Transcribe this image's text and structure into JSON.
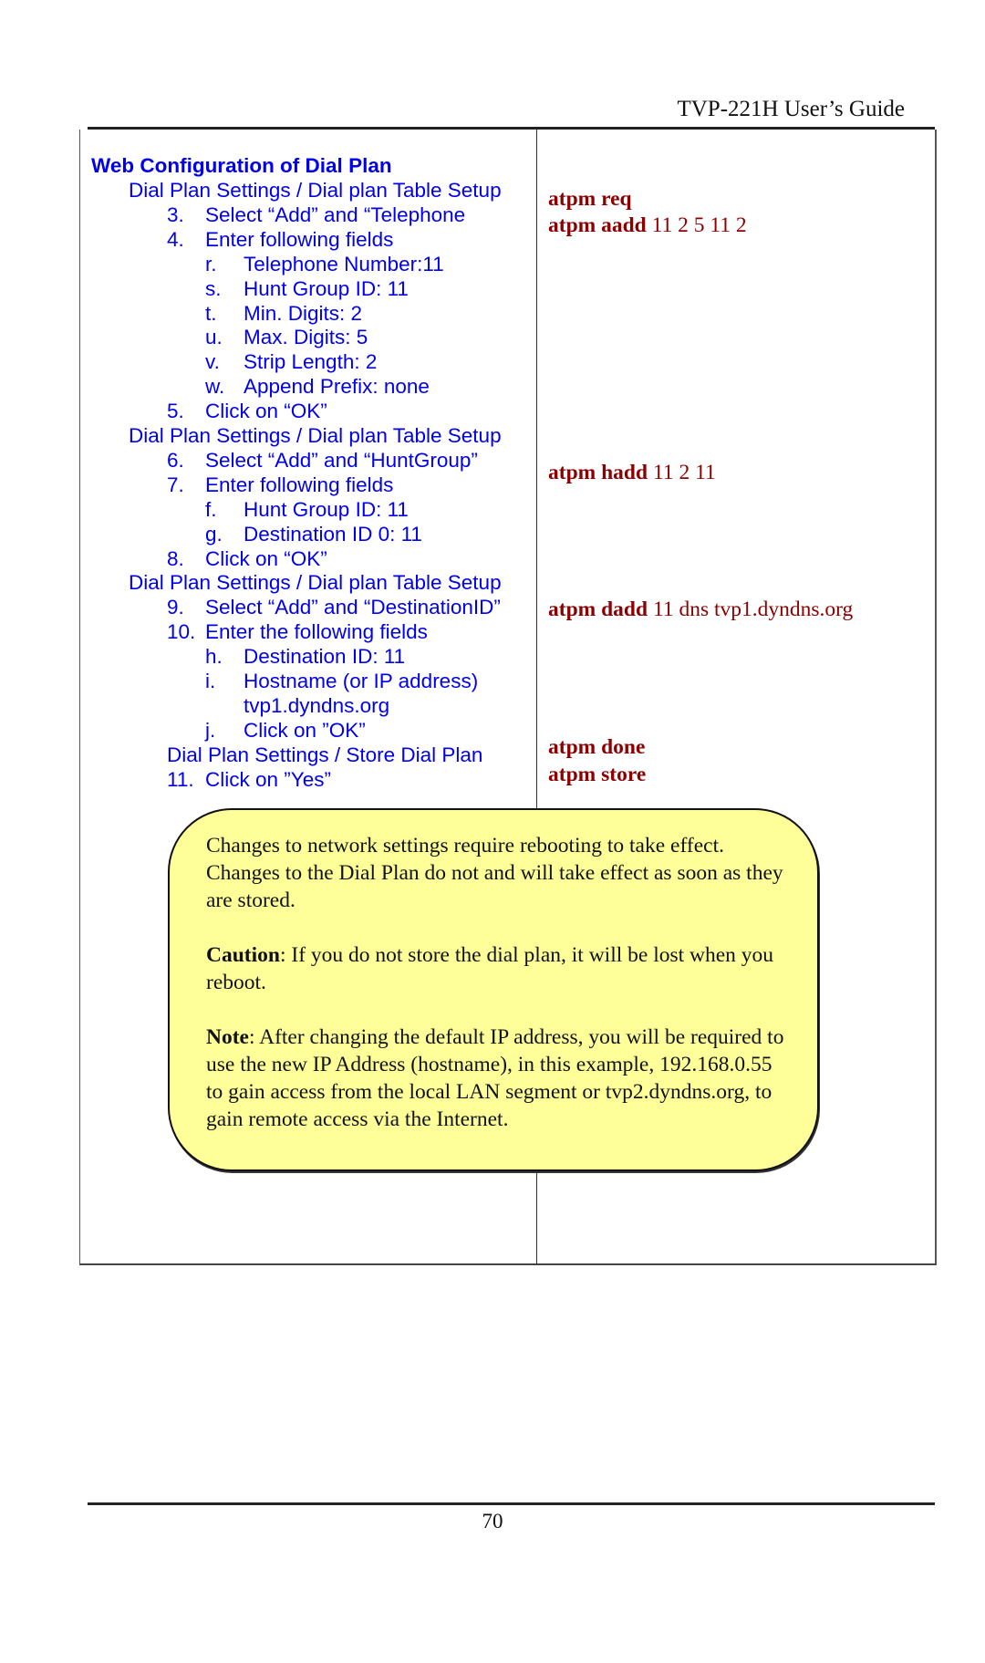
{
  "header": {
    "title": "TVP-221H User’s Guide"
  },
  "left_column": {
    "heading": "Web Configuration of Dial Plan",
    "lines": [
      {
        "kind": "section",
        "text": "Dial Plan Settings / Dial plan Table Setup"
      },
      {
        "kind": "step",
        "marker": "3.",
        "text": "Select “Add” and “Telephone"
      },
      {
        "kind": "step",
        "marker": "4.",
        "text": "Enter following fields"
      },
      {
        "kind": "sub",
        "marker": "r.",
        "text": "Telephone Number:11"
      },
      {
        "kind": "sub",
        "marker": "s.",
        "text": "Hunt Group ID:  11"
      },
      {
        "kind": "sub",
        "marker": "t.",
        "text": "Min. Digits:  2"
      },
      {
        "kind": "sub",
        "marker": "u.",
        "text": "Max. Digits:  5"
      },
      {
        "kind": "sub",
        "marker": "v.",
        "text": "Strip Length:  2"
      },
      {
        "kind": "sub",
        "marker": "w.",
        "text": "Append Prefix: none"
      },
      {
        "kind": "step",
        "marker": "5.",
        "text": "Click on “OK”"
      },
      {
        "kind": "section",
        "text": "Dial Plan Settings / Dial plan Table Setup"
      },
      {
        "kind": "step",
        "marker": "6.",
        "text": "Select “Add” and “HuntGroup”"
      },
      {
        "kind": "step",
        "marker": "7.",
        "text": "Enter following fields"
      },
      {
        "kind": "sub",
        "marker": "f.",
        "text": "Hunt Group ID: 11"
      },
      {
        "kind": "sub",
        "marker": "g.",
        "text": "Destination ID 0: 11"
      },
      {
        "kind": "step",
        "marker": "8.",
        "text": "Click on “OK”"
      },
      {
        "kind": "section",
        "text": "Dial Plan Settings / Dial plan Table Setup"
      },
      {
        "kind": "step",
        "marker": "9.",
        "text": "Select “Add” and “DestinationID”"
      },
      {
        "kind": "step",
        "marker": "10.",
        "text": "Enter the following fields"
      },
      {
        "kind": "sub",
        "marker": "h.",
        "text": "Destination ID: 11"
      },
      {
        "kind": "sub",
        "marker": "i.",
        "text": "Hostname (or IP address)"
      },
      {
        "kind": "subcont",
        "marker": "",
        "text": "tvp1.dyndns.org"
      },
      {
        "kind": "sub",
        "marker": "j.",
        "text": "Click on ”OK”"
      },
      {
        "kind": "section2",
        "text": "Dial Plan Settings / Store Dial Plan"
      },
      {
        "kind": "step",
        "marker": "11.",
        "text": "Click on ”Yes”"
      }
    ]
  },
  "right_column": {
    "commands": [
      {
        "cmd": "atpm req",
        "args": ""
      },
      {
        "cmd": "atpm aadd",
        "args": " 11 2 5 11 2"
      },
      {
        "cmd": "atpm hadd",
        "args": " 11 2 11"
      },
      {
        "cmd": "atpm dadd",
        "args": " 11 dns tvp1.dyndns.org"
      },
      {
        "cmd": "atpm done",
        "args": ""
      },
      {
        "cmd": "atpm store",
        "args": ""
      }
    ]
  },
  "callout": {
    "paragraph1": "Changes to network settings require rebooting to take effect. Changes to the Dial Plan do not and will take effect as soon as they are stored.",
    "caution_label": "Caution",
    "caution_text": ": If you do not store the dial plan, it will be lost when you reboot.",
    "note_label": "Note",
    "note_text": ":  After changing the default IP address, you will be required to use the new IP Address (hostname), in this example, 192.168.0.55 to gain access from the local LAN segment or  tvp2.dyndns.org, to gain remote access via the Internet."
  },
  "footer": {
    "page_number": "70"
  },
  "colors": {
    "instruction_blue": "#0000ee",
    "command_red": "#8b0000",
    "callout_yellow": "#ffff99"
  }
}
